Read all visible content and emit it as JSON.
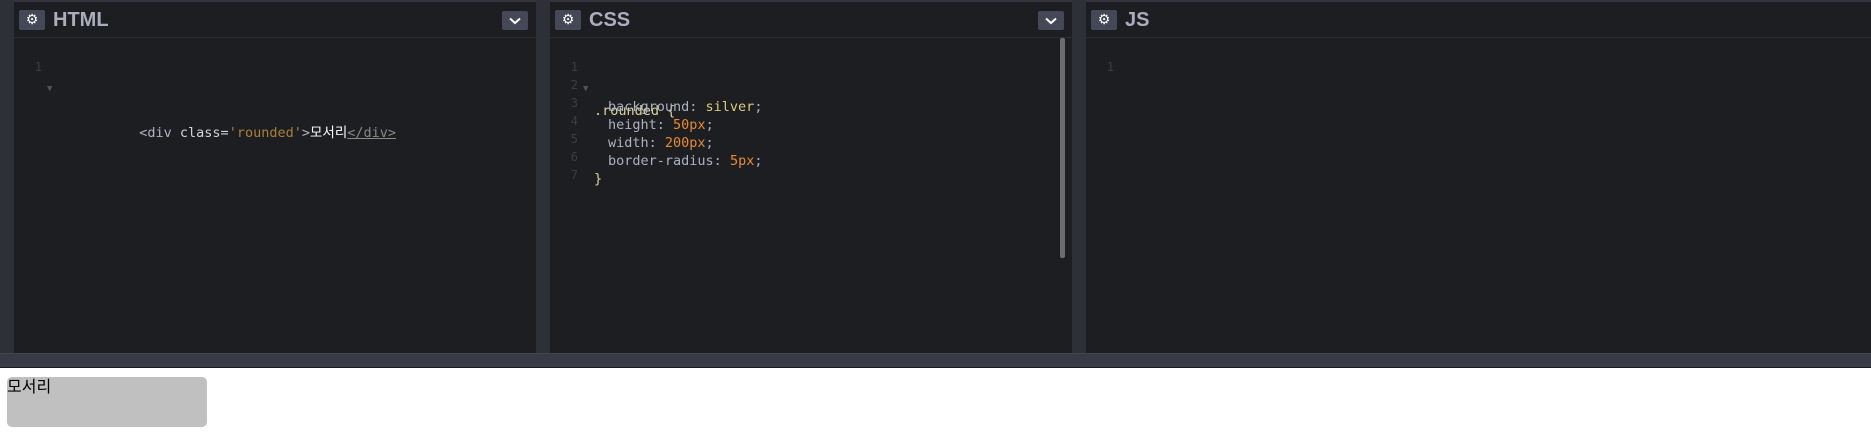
{
  "panels": {
    "html": {
      "title": "HTML",
      "settings_icon": "gear-icon",
      "collapse_icon": "chevron-down-icon",
      "lines": [
        {
          "num": "1",
          "tag_open": "<div ",
          "attr": "class=",
          "str": "'rounded'",
          "tag_end": ">",
          "text": "모서리",
          "close": "</div>"
        }
      ]
    },
    "css": {
      "title": "CSS",
      "settings_icon": "gear-icon",
      "collapse_icon": "chevron-down-icon",
      "lines": [
        {
          "num": "1",
          "code": ".rounded {"
        },
        {
          "num": "2",
          "prop": "background",
          "value": "silver"
        },
        {
          "num": "3",
          "prop": "height",
          "value": "50px"
        },
        {
          "num": "4",
          "prop": "width",
          "value": "200px"
        },
        {
          "num": "5",
          "prop": "border-radius",
          "value": "5px"
        },
        {
          "num": "6",
          "code": "}"
        },
        {
          "num": "7",
          "code": ""
        }
      ]
    },
    "js": {
      "title": "JS",
      "settings_icon": "gear-icon",
      "lines": [
        {
          "num": "1",
          "code": ""
        }
      ]
    }
  },
  "preview": {
    "text": "모서리",
    "background": "#c0c0c0"
  },
  "colors": {
    "editor_bg": "#1d1e22",
    "header_button": "#444857",
    "string": "#a88038",
    "number": "#e88933"
  }
}
